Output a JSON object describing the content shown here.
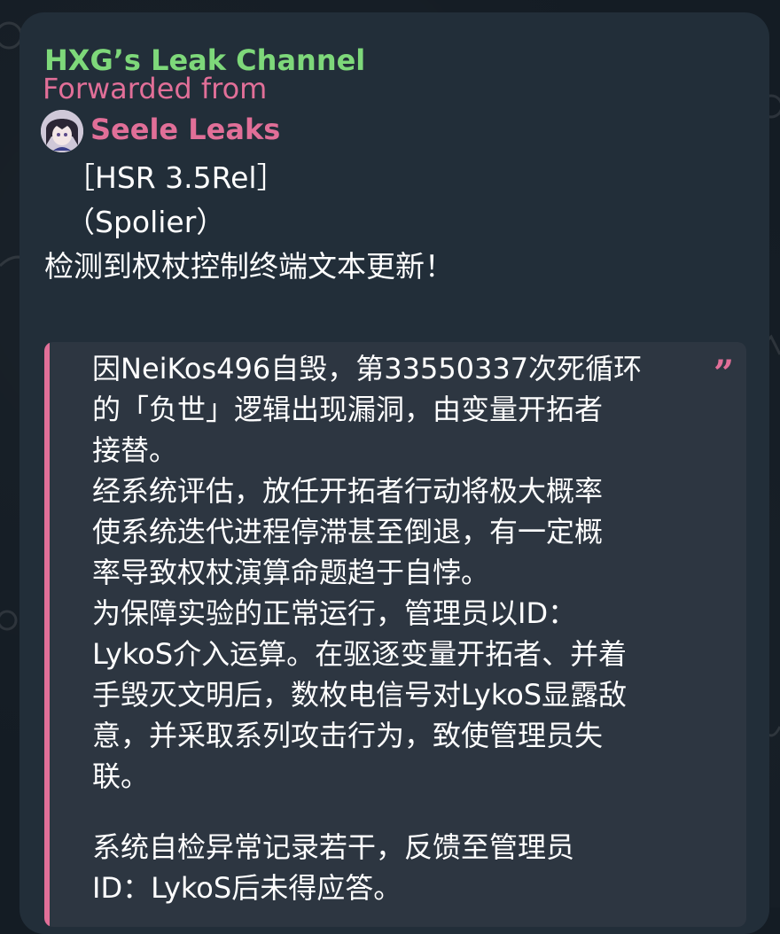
{
  "message": {
    "channel_name": "HXG’s Leak Channel",
    "forwarded_label": "Forwarded from",
    "source_name": "Seele Leaks",
    "lines": [
      "［HSR 3.5Rel］",
      "（Spolier）",
      "检测到权杖控制终端文本更新！"
    ],
    "quote": {
      "icon": "quote-marks-icon",
      "lines": [
        "因NeiKos496自毁，第33550337次死循环",
        "的「负世」逻辑出现漏洞，由变量开拓者",
        "接替。",
        "经系统评估，放任开拓者行动将极大概率",
        "使系统迭代进程停滞甚至倒退，有一定概",
        "率导致权杖演算命题趋于自悖。",
        "为保障实验的正常运行，管理员以ID：",
        "LykoS介入运算。在驱逐变量开拓者、并着",
        "手毁灭文明后，数枚电信号对LykoS显露敌",
        "意，并采取系列攻击行为，致使管理员失",
        "联。",
        "",
        "系统自检异常记录若干，反馈至管理员",
        "ID：LykoS后未得应答。"
      ]
    }
  },
  "colors": {
    "channel_name": "#7ed87a",
    "accent_pink": "#e16f98",
    "bubble_bg": "#222e39",
    "quote_bg": "#2d3641",
    "text": "#ffffff"
  }
}
